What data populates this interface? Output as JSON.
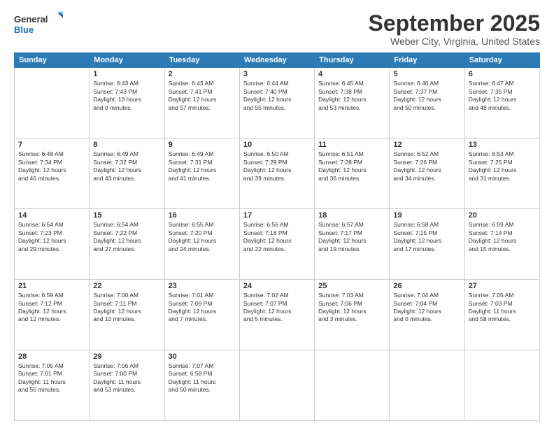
{
  "logo": {
    "line1": "General",
    "line2": "Blue"
  },
  "header": {
    "month": "September 2025",
    "location": "Weber City, Virginia, United States"
  },
  "weekdays": [
    "Sunday",
    "Monday",
    "Tuesday",
    "Wednesday",
    "Thursday",
    "Friday",
    "Saturday"
  ],
  "weeks": [
    [
      {
        "day": "",
        "info": ""
      },
      {
        "day": "1",
        "info": "Sunrise: 6:43 AM\nSunset: 7:43 PM\nDaylight: 13 hours\nand 0 minutes."
      },
      {
        "day": "2",
        "info": "Sunrise: 6:43 AM\nSunset: 7:41 PM\nDaylight: 12 hours\nand 57 minutes."
      },
      {
        "day": "3",
        "info": "Sunrise: 6:44 AM\nSunset: 7:40 PM\nDaylight: 12 hours\nand 55 minutes."
      },
      {
        "day": "4",
        "info": "Sunrise: 6:45 AM\nSunset: 7:38 PM\nDaylight: 12 hours\nand 53 minutes."
      },
      {
        "day": "5",
        "info": "Sunrise: 6:46 AM\nSunset: 7:37 PM\nDaylight: 12 hours\nand 50 minutes."
      },
      {
        "day": "6",
        "info": "Sunrise: 6:47 AM\nSunset: 7:35 PM\nDaylight: 12 hours\nand 48 minutes."
      }
    ],
    [
      {
        "day": "7",
        "info": "Sunrise: 6:48 AM\nSunset: 7:34 PM\nDaylight: 12 hours\nand 46 minutes."
      },
      {
        "day": "8",
        "info": "Sunrise: 6:49 AM\nSunset: 7:32 PM\nDaylight: 12 hours\nand 43 minutes."
      },
      {
        "day": "9",
        "info": "Sunrise: 6:49 AM\nSunset: 7:31 PM\nDaylight: 12 hours\nand 41 minutes."
      },
      {
        "day": "10",
        "info": "Sunrise: 6:50 AM\nSunset: 7:29 PM\nDaylight: 12 hours\nand 39 minutes."
      },
      {
        "day": "11",
        "info": "Sunrise: 6:51 AM\nSunset: 7:28 PM\nDaylight: 12 hours\nand 36 minutes."
      },
      {
        "day": "12",
        "info": "Sunrise: 6:52 AM\nSunset: 7:26 PM\nDaylight: 12 hours\nand 34 minutes."
      },
      {
        "day": "13",
        "info": "Sunrise: 6:53 AM\nSunset: 7:25 PM\nDaylight: 12 hours\nand 31 minutes."
      }
    ],
    [
      {
        "day": "14",
        "info": "Sunrise: 6:54 AM\nSunset: 7:23 PM\nDaylight: 12 hours\nand 29 minutes."
      },
      {
        "day": "15",
        "info": "Sunrise: 6:54 AM\nSunset: 7:22 PM\nDaylight: 12 hours\nand 27 minutes."
      },
      {
        "day": "16",
        "info": "Sunrise: 6:55 AM\nSunset: 7:20 PM\nDaylight: 12 hours\nand 24 minutes."
      },
      {
        "day": "17",
        "info": "Sunrise: 6:56 AM\nSunset: 7:18 PM\nDaylight: 12 hours\nand 22 minutes."
      },
      {
        "day": "18",
        "info": "Sunrise: 6:57 AM\nSunset: 7:17 PM\nDaylight: 12 hours\nand 19 minutes."
      },
      {
        "day": "19",
        "info": "Sunrise: 6:58 AM\nSunset: 7:15 PM\nDaylight: 12 hours\nand 17 minutes."
      },
      {
        "day": "20",
        "info": "Sunrise: 6:59 AM\nSunset: 7:14 PM\nDaylight: 12 hours\nand 15 minutes."
      }
    ],
    [
      {
        "day": "21",
        "info": "Sunrise: 6:59 AM\nSunset: 7:12 PM\nDaylight: 12 hours\nand 12 minutes."
      },
      {
        "day": "22",
        "info": "Sunrise: 7:00 AM\nSunset: 7:11 PM\nDaylight: 12 hours\nand 10 minutes."
      },
      {
        "day": "23",
        "info": "Sunrise: 7:01 AM\nSunset: 7:09 PM\nDaylight: 12 hours\nand 7 minutes."
      },
      {
        "day": "24",
        "info": "Sunrise: 7:02 AM\nSunset: 7:07 PM\nDaylight: 12 hours\nand 5 minutes."
      },
      {
        "day": "25",
        "info": "Sunrise: 7:03 AM\nSunset: 7:06 PM\nDaylight: 12 hours\nand 3 minutes."
      },
      {
        "day": "26",
        "info": "Sunrise: 7:04 AM\nSunset: 7:04 PM\nDaylight: 12 hours\nand 0 minutes."
      },
      {
        "day": "27",
        "info": "Sunrise: 7:05 AM\nSunset: 7:03 PM\nDaylight: 11 hours\nand 58 minutes."
      }
    ],
    [
      {
        "day": "28",
        "info": "Sunrise: 7:05 AM\nSunset: 7:01 PM\nDaylight: 11 hours\nand 55 minutes."
      },
      {
        "day": "29",
        "info": "Sunrise: 7:06 AM\nSunset: 7:00 PM\nDaylight: 11 hours\nand 53 minutes."
      },
      {
        "day": "30",
        "info": "Sunrise: 7:07 AM\nSunset: 6:58 PM\nDaylight: 11 hours\nand 50 minutes."
      },
      {
        "day": "",
        "info": ""
      },
      {
        "day": "",
        "info": ""
      },
      {
        "day": "",
        "info": ""
      },
      {
        "day": "",
        "info": ""
      }
    ]
  ]
}
